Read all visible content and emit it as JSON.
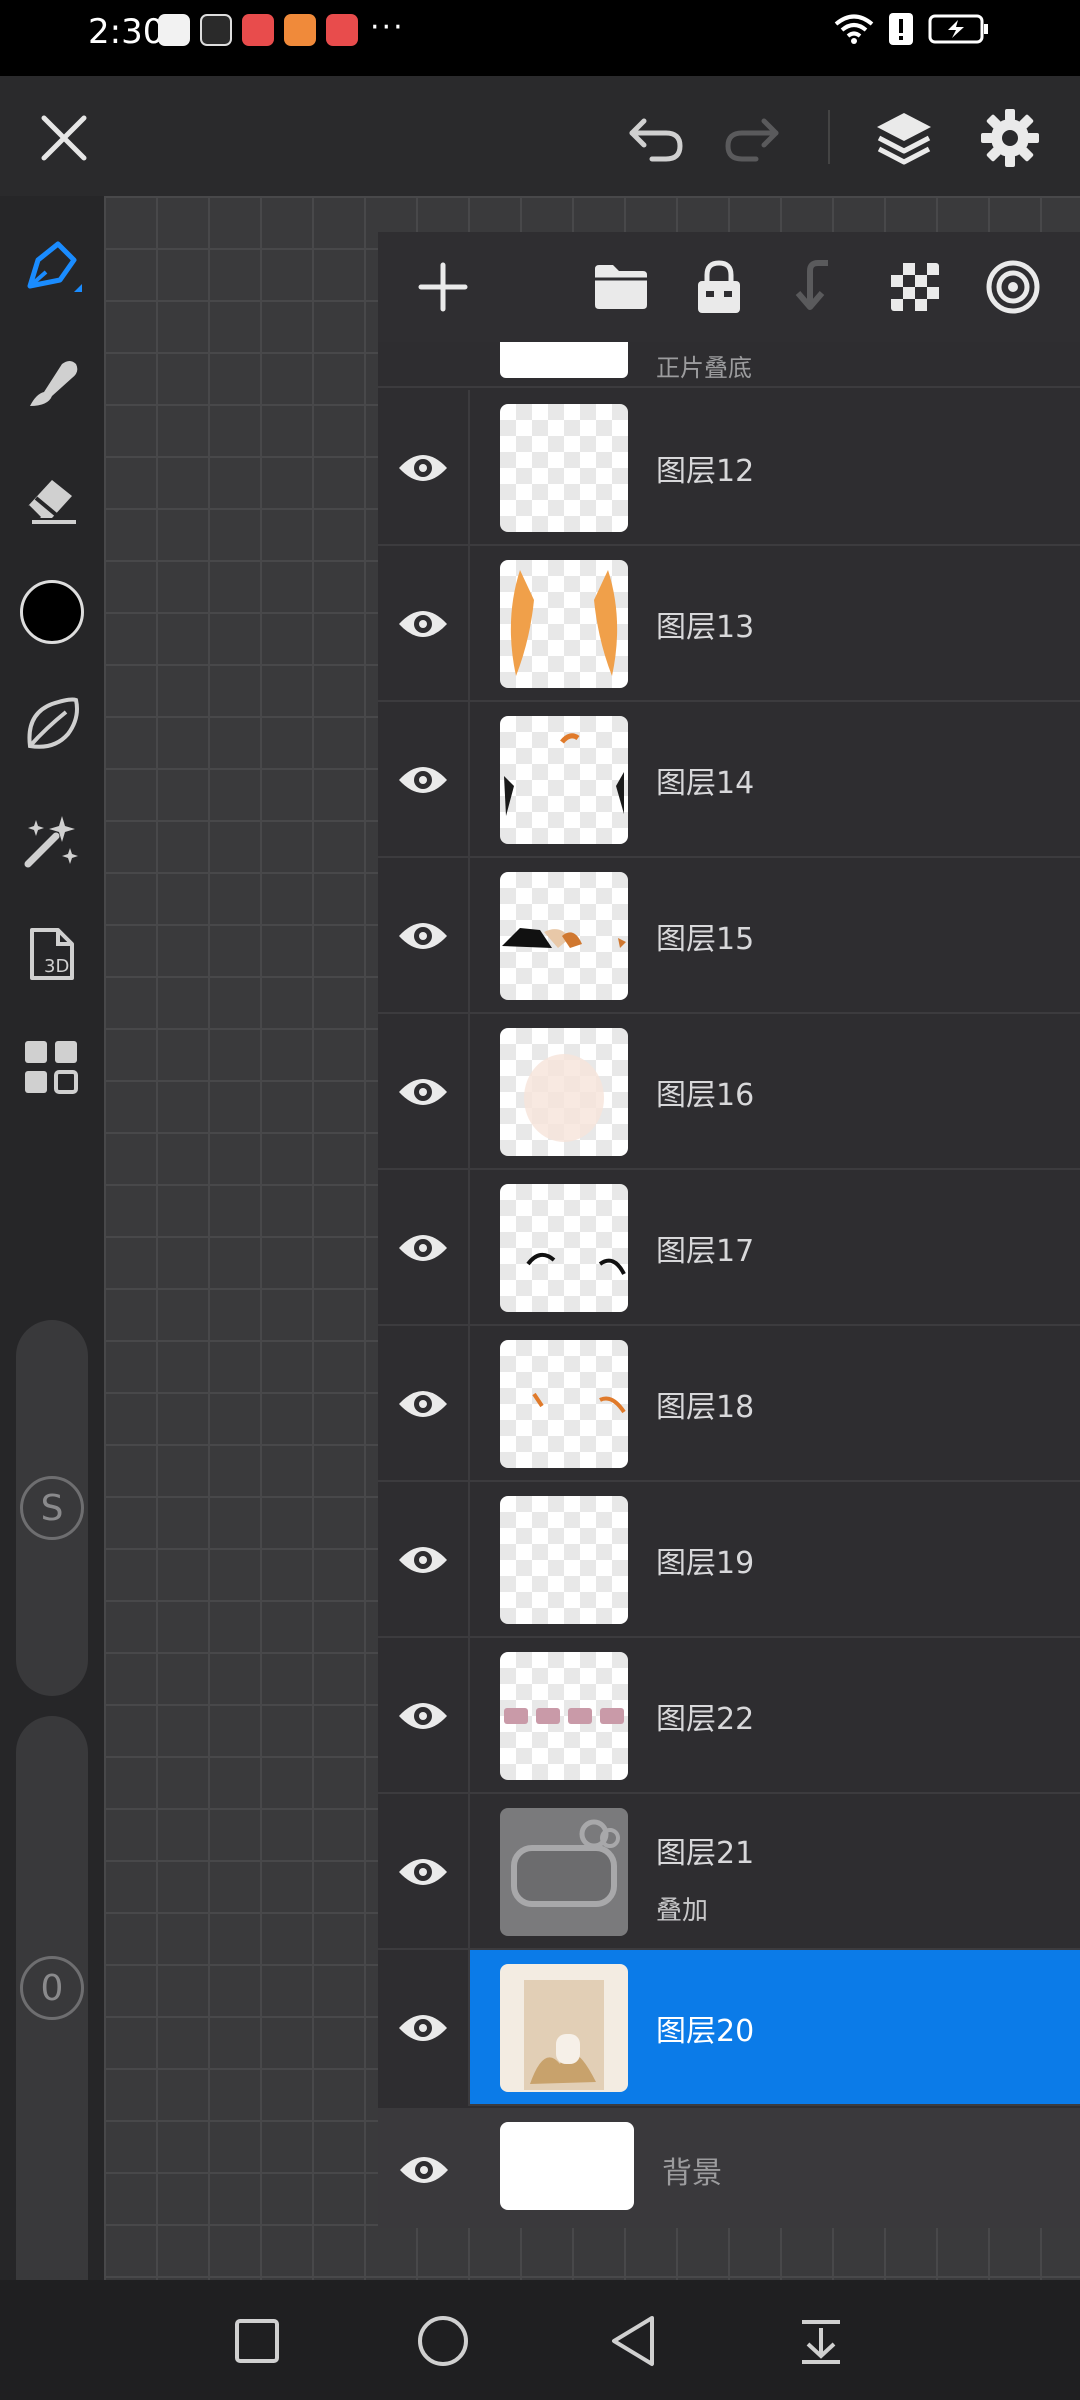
{
  "status_bar": {
    "time": "2:30",
    "more": "···",
    "app_colors": [
      "#f2f2f2",
      "#d9d9d9",
      "#e84c4c",
      "#f08a3a",
      "#e84c4c"
    ]
  },
  "toolbar": {
    "icons": [
      "close-icon",
      "undo-icon",
      "redo-icon",
      "layers-icon",
      "gear-icon"
    ]
  },
  "tools": {
    "brush_color": "#000000",
    "accent": "#1a8cff",
    "slider_size_label": "S",
    "slider_opacity_label": "0"
  },
  "layer_panel": {
    "partial_layer_name": "正片叠底",
    "layers": [
      {
        "name": "图层12",
        "mode": "",
        "selected": false
      },
      {
        "name": "图层13",
        "mode": "",
        "selected": false
      },
      {
        "name": "图层14",
        "mode": "",
        "selected": false
      },
      {
        "name": "图层15",
        "mode": "",
        "selected": false
      },
      {
        "name": "图层16",
        "mode": "",
        "selected": false
      },
      {
        "name": "图层17",
        "mode": "",
        "selected": false
      },
      {
        "name": "图层18",
        "mode": "",
        "selected": false
      },
      {
        "name": "图层19",
        "mode": "",
        "selected": false
      },
      {
        "name": "图层22",
        "mode": "",
        "selected": false
      },
      {
        "name": "图层21",
        "mode": "叠加",
        "selected": false
      },
      {
        "name": "图层20",
        "mode": "",
        "selected": true
      }
    ],
    "background_label": "背景",
    "selected_color": "#0b7be8"
  },
  "nav_bar": {
    "icons": [
      "recents-square-icon",
      "home-circle-icon",
      "back-triangle-icon",
      "notification-shade-icon"
    ]
  }
}
